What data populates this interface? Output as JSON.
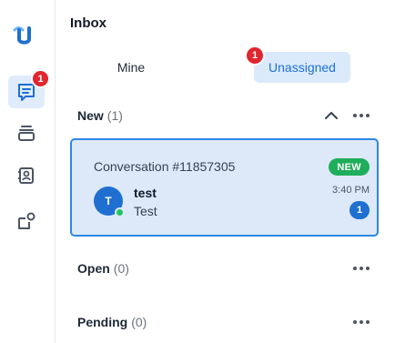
{
  "rail": {
    "items": [
      {
        "name": "conversations",
        "badge": "1",
        "active": true
      },
      {
        "name": "stack",
        "active": false
      },
      {
        "name": "contacts",
        "active": false
      },
      {
        "name": "integrations",
        "active": false
      }
    ]
  },
  "inbox": {
    "title": "Inbox",
    "tabs": [
      {
        "label": "Mine"
      },
      {
        "label": "Unassigned",
        "badge": "1"
      }
    ],
    "sections": {
      "new": {
        "name": "New",
        "count": "(1)"
      },
      "open": {
        "name": "Open",
        "count": "(0)"
      },
      "pending": {
        "name": "Pending",
        "count": "(0)"
      }
    },
    "conversation": {
      "title": "Conversation #11857305",
      "status_badge": "NEW",
      "avatar_initial": "T",
      "contact_name": "test",
      "preview": "Test",
      "time": "3:40 PM",
      "unread": "1"
    }
  },
  "colors": {
    "accent": "#1f6fd1",
    "badge_red": "#e0262f",
    "new_green": "#1fae5b",
    "card_bg": "#dde9f8"
  }
}
